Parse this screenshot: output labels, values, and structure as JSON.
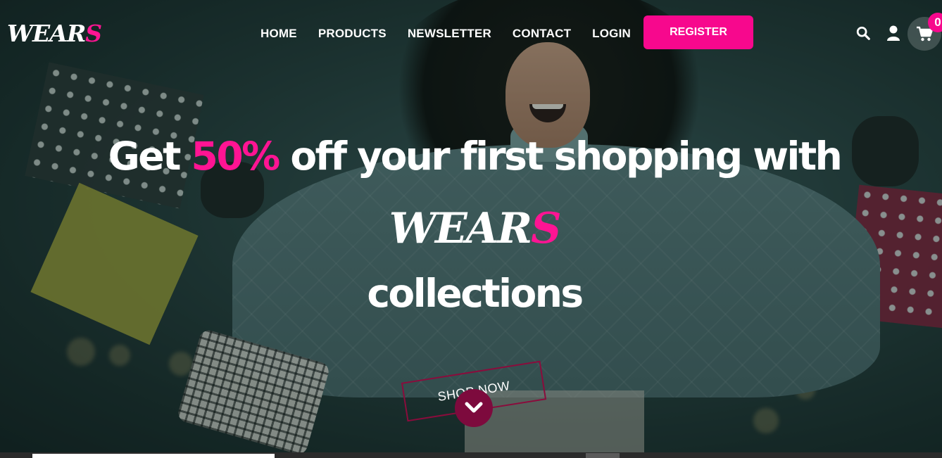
{
  "logo": {
    "main": "WEAR",
    "accent": "S"
  },
  "nav": {
    "items": [
      {
        "label": "HOME"
      },
      {
        "label": "PRODUCTS"
      },
      {
        "label": "NEWSLETTER"
      },
      {
        "label": "CONTACT"
      },
      {
        "label": "LOGIN"
      }
    ],
    "register_label": "REGISTER"
  },
  "header_icons": [
    "search-icon",
    "user-icon",
    "cart-icon"
  ],
  "cart": {
    "count": "0"
  },
  "hero": {
    "headline_part1": "Get ",
    "headline_highlight": "50%",
    "headline_part2": " off your first shopping with",
    "brand_main": "WEAR",
    "brand_accent": "S",
    "headline_line3": "collections",
    "cta_label": "SHOP NOW"
  },
  "colors": {
    "accent": "#f7088d",
    "dark_accent": "#7d0a3d"
  }
}
